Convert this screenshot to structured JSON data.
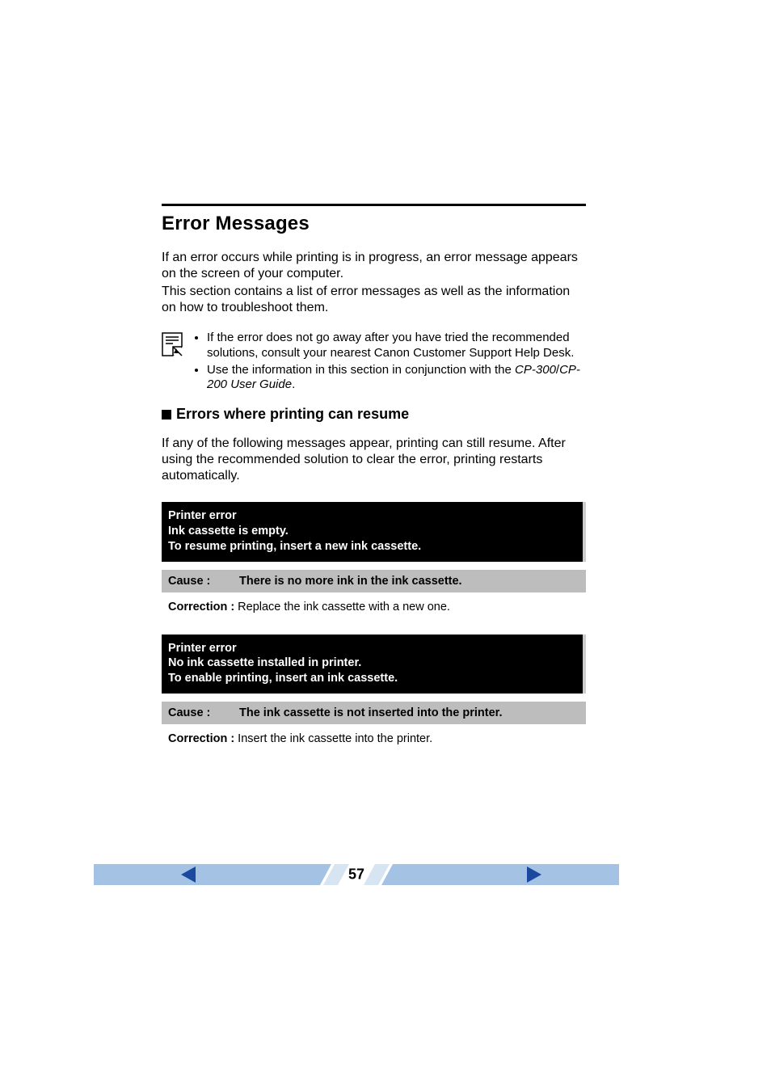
{
  "title": "Error Messages",
  "intro1": "If an error occurs while printing is in progress, an error message appears on the screen of your computer.",
  "intro2": "This section contains a list of error messages as well as the information on how to troubleshoot them.",
  "notes": {
    "b1": "If the error does not go away after you have tried the recommended solutions, consult your nearest Canon Customer Support Help Desk.",
    "b2_pre": "Use the information in this section in conjunction with the ",
    "b2_it1": "CP-300",
    "b2_sep": "/",
    "b2_it2": "CP-200 User Guide",
    "b2_post": "."
  },
  "section_heading": "Errors where printing can resume",
  "resume_text": "If any of the following messages appear, printing can still resume. After using the recommended solution to clear the error, printing restarts automatically.",
  "errors": [
    {
      "header_l1": "Printer error",
      "header_l2": "Ink cassette is empty.",
      "header_l3": "To resume printing, insert a new ink cassette.",
      "cause_label": "Cause :",
      "cause_text": "There is no more ink in the ink cassette.",
      "correction_label": "Correction :",
      "correction_text": "Replace the ink cassette with a new one."
    },
    {
      "header_l1": "Printer error",
      "header_l2": "No ink cassette installed in printer.",
      "header_l3": "To enable printing, insert an ink cassette.",
      "cause_label": "Cause :",
      "cause_text": "The ink cassette is not inserted into the printer.",
      "correction_label": "Correction :",
      "correction_text": "Insert the ink cassette into the printer."
    }
  ],
  "page_number": "57"
}
